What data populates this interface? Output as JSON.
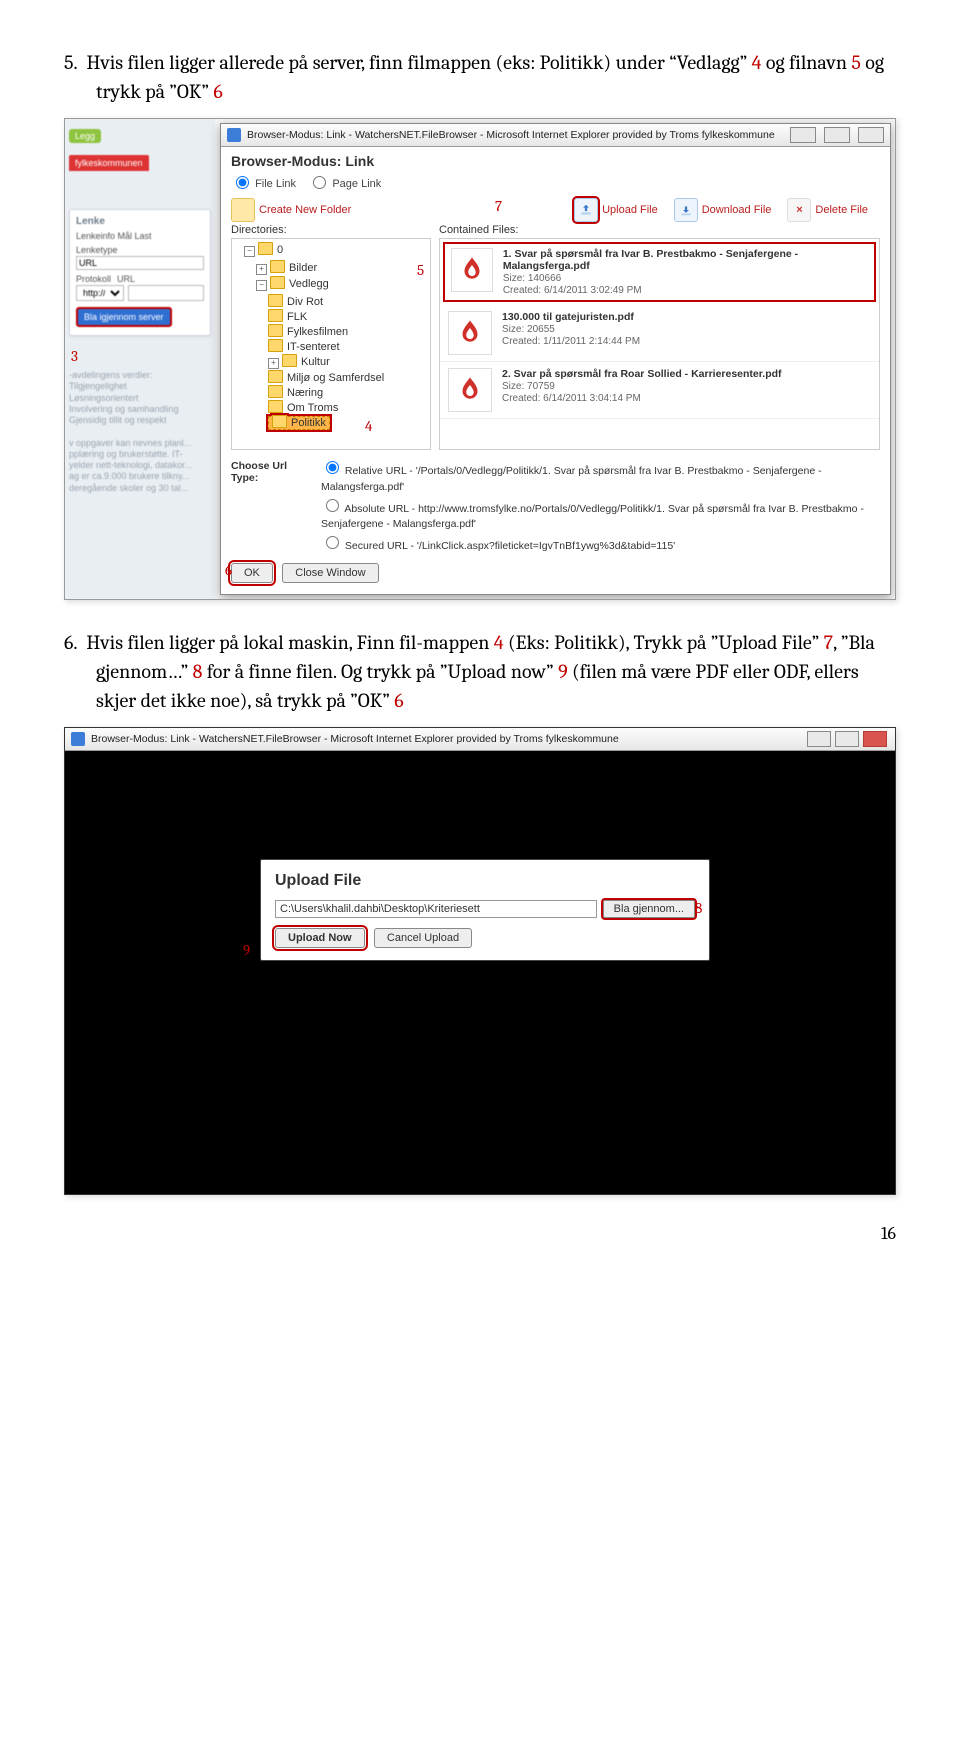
{
  "page_number": "16",
  "para5": {
    "num": "5.",
    "text_a": "Hvis filen ligger allerede på server, finn filmappen (eks: Politikk) under “Vedlagg” ",
    "r1": "4",
    "text_b": " og filnavn ",
    "r2": "5",
    "text_c": " og trykk på ”OK” ",
    "r3": "6"
  },
  "para6": {
    "num": "6.",
    "text_a": "Hvis filen ligger på lokal maskin, Finn fil-mappen ",
    "r1": "4",
    "text_b": " (Eks: Politikk), Trykk på ”Upload File” ",
    "r2": "7",
    "text_c": ", ”Bla gjennom…” ",
    "r3": "8",
    "text_d": " for å finne filen. Og trykk på ”Upload now” ",
    "r4": "9",
    "text_e": " (filen må være PDF eller ODF, ellers skjer det ikke noe), så trykk på ”OK” ",
    "r5": "6"
  },
  "shot1": {
    "titlebar": "Browser-Modus: Link - WatchersNET.FileBrowser - Microsoft Internet Explorer provided by Troms fylkeskommune",
    "mode_label": "Browser-Modus: Link",
    "radio_file": "File Link",
    "radio_page": "Page Link",
    "toolbar": {
      "create": "Create New Folder",
      "upload": "Upload File",
      "download": "Download File",
      "delete": "Delete File"
    },
    "col_headings": {
      "left": "Directories:",
      "right": "Contained Files:"
    },
    "tree": {
      "root": "0",
      "items": [
        "Bilder",
        "Vedlegg",
        "Div Rot",
        "FLK",
        "Fylkesfilmen",
        "IT-senteret",
        "Kultur",
        "Miljø og Samferdsel",
        "Næring",
        "Om Troms",
        "Politikk"
      ]
    },
    "files": [
      {
        "name": "1. Svar på spørsmål fra Ivar B. Prestbakmo - Senjafergene - Malangsferga.pdf",
        "size": "Size: 140666",
        "created": "Created: 6/14/2011 3:02:49 PM"
      },
      {
        "name": "130.000 til gatejuristen.pdf",
        "size": "Size: 20655",
        "created": "Created: 1/11/2011 2:14:44 PM"
      },
      {
        "name": "2. Svar på spørsmål fra Roar Sollied - Karrieresenter.pdf",
        "size": "Size: 70759",
        "created": "Created: 6/14/2011 3:04:14 PM"
      }
    ],
    "url_label": "Choose Url Type:",
    "url_options": [
      "Relative URL - '/Portals/0/Vedlegg/Politikk/1. Svar på spørsmål fra Ivar B. Prestbakmo - Senjafergene - Malangsferga.pdf'",
      "Absolute URL - http://www.tromsfylke.no/Portals/0/Vedlegg/Politikk/1. Svar på spørsmål fra Ivar B. Prestbakmo - Senjafergene - Malangsferga.pdf'",
      "Secured URL - '/LinkClick.aspx?fileticket=IgvTnBf1ywg%3d&tabid=115'"
    ],
    "ok": "OK",
    "close": "Close Window",
    "side": {
      "pill": "Legg",
      "redtab": "fylkeskommunen",
      "card_title": "Lenke",
      "row": "Lenkeinfo  Mål  Last",
      "label1": "Lenketype",
      "val1": "URL",
      "label2": "Protokoll",
      "val2": "http://",
      "label3": "URL",
      "btn": "Bla igjennom server",
      "lower": "-avdelingens verdier:\nTilgjengelighet\nLøsningsorientert\nInvolvering og samhandling\nGjensidig tillit og respekt\n\nv oppgaver kan nevnes planl...\npplæring og brukerstøtte. IT-\nyelder nett-teknologi, datakor...\nag er ca.9.000 brukere tilkny...\nderegående skoler og 30 tal..."
    },
    "callouts": {
      "c3": "3",
      "c4": "4",
      "c5": "5",
      "c6": "6",
      "c7": "7"
    }
  },
  "shot2": {
    "titlebar": "Browser-Modus: Link - WatchersNET.FileBrowser - Microsoft Internet Explorer provided by Troms fylkeskommune",
    "panel_title": "Upload File",
    "path": "C:\\Users\\khalil.dahbi\\Desktop\\Kriteriesett",
    "browse": "Bla gjennom...",
    "upload_now": "Upload Now",
    "cancel": "Cancel Upload",
    "c8": "8",
    "c9": "9"
  }
}
